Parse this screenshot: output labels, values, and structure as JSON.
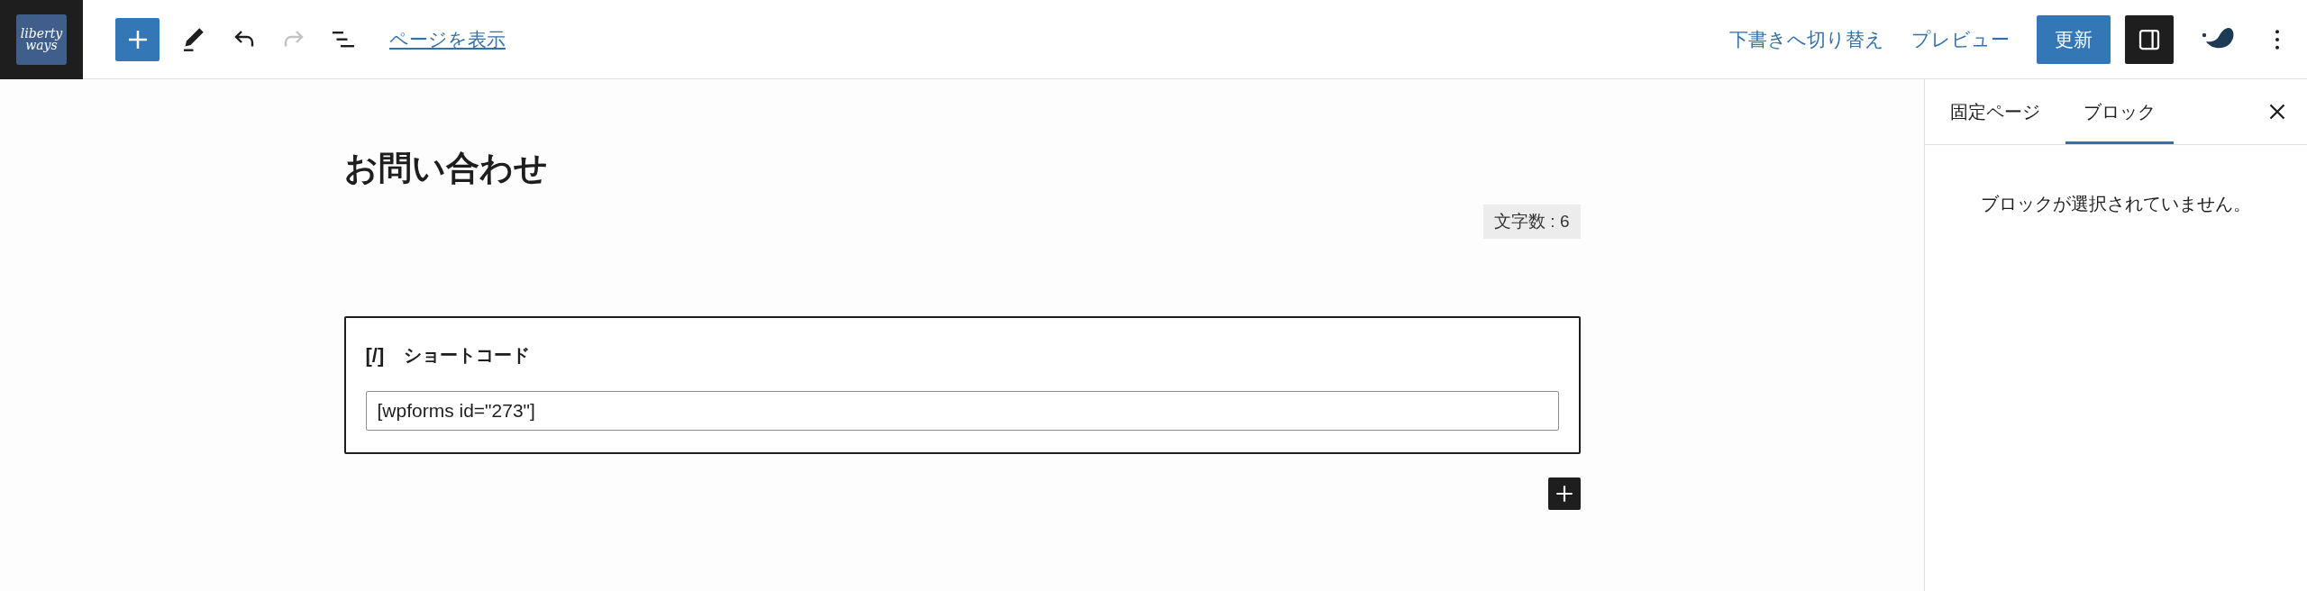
{
  "header": {
    "logo": {
      "text": "liberty ways"
    },
    "tools": [
      {
        "kind": "add",
        "disabled": false
      },
      {
        "kind": "pen",
        "disabled": false
      },
      {
        "kind": "undo",
        "disabled": false
      },
      {
        "kind": "redo",
        "disabled": true
      },
      {
        "kind": "list",
        "disabled": false
      }
    ],
    "view_link": "ページを表示",
    "links": [
      "下書きへ切り替え",
      "プレビュー"
    ],
    "update_button": "更新",
    "settings_toggle": {
      "pressed": true
    },
    "extras": [
      {
        "kind": "plugin"
      },
      {
        "kind": "more"
      }
    ]
  },
  "editor": {
    "title": "お問い合わせ",
    "word_count": "文字数 : 6",
    "block": {
      "icon": "[/]",
      "label": "ショートコード",
      "value": "[wpforms id=\"273\"]"
    }
  },
  "sidebar": {
    "tabs": [
      {
        "label": "固定ページ",
        "selected": false
      },
      {
        "label": "ブロック",
        "selected": true
      }
    ],
    "message": "ブロックが選択されていません。"
  }
}
